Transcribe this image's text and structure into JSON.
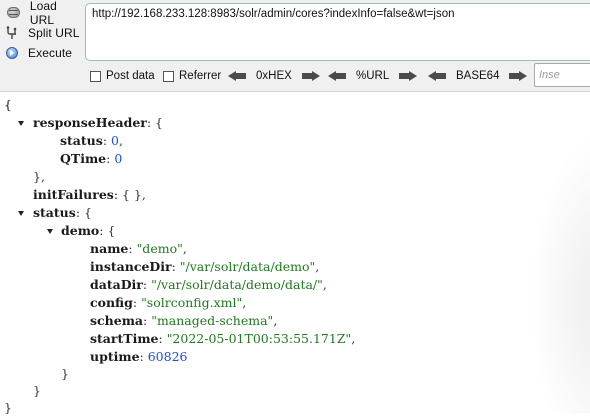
{
  "toolbar": {
    "load_url_label": "Load URL",
    "split_url_label": "Split URL",
    "execute_label": "Execute",
    "url_value": "http://192.168.233.128:8983/solr/admin/cores?indexInfo=false&wt=json",
    "post_data_label": "Post data",
    "referrer_label": "Referrer",
    "hex_label": "0xHEX",
    "url_encode_label": "%URL",
    "base64_label": "BASE64",
    "small_input_placeholder": "Inse"
  },
  "json": {
    "open_brace": "{",
    "responseHeader_key": "responseHeader",
    "status_key": "status",
    "status_value": "0",
    "qtime_key": "QTime",
    "qtime_value": "0",
    "initFailures_key": "initFailures",
    "initFailures_value": "{ }",
    "status_obj_key": "status",
    "demo_key": "demo",
    "name_key": "name",
    "name_value": "\"demo\"",
    "instanceDir_key": "instanceDir",
    "instanceDir_value": "\"/var/solr/data/demo\"",
    "dataDir_key": "dataDir",
    "dataDir_value": "\"/var/solr/data/demo/data/\"",
    "config_key": "config",
    "config_value": "\"solrconfig.xml\"",
    "schema_key": "schema",
    "schema_value": "\"managed-schema\"",
    "startTime_key": "startTime",
    "startTime_value": "\"2022-05-01T00:53:55.171Z\"",
    "uptime_key": "uptime",
    "uptime_value": "60826"
  },
  "icons": [
    "load-url-icon",
    "split-url-icon",
    "execute-icon",
    "arrow-left-icon",
    "arrow-right-icon",
    "collapse-triangle-icon"
  ],
  "colors": {
    "json_number": "#1d4fd6",
    "json_string": "#1e7a1e",
    "url_box_border": "#9ac2a6"
  }
}
